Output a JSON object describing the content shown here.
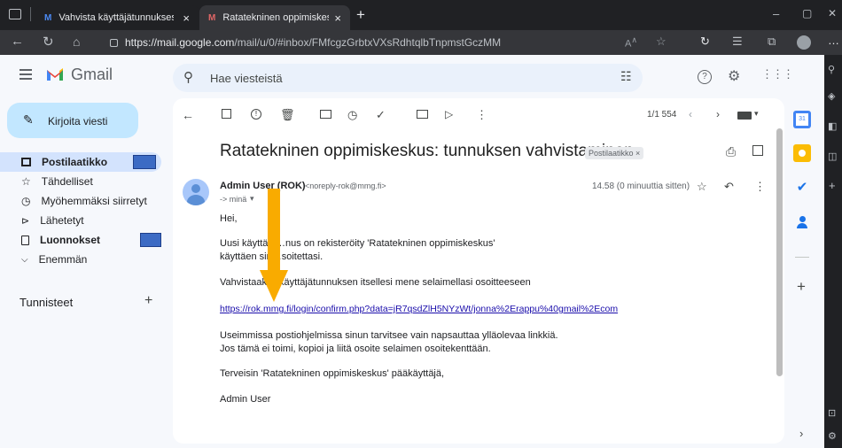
{
  "browser": {
    "tabs": [
      {
        "title": "Vahvista käyttäjätunnuksesi",
        "close": "×"
      },
      {
        "title": "Ratatekninen oppimiskeskus: tun",
        "close": "×"
      }
    ],
    "new_tab": "+",
    "window_controls": {
      "minimize": "–",
      "restore": "▢",
      "close": "✕"
    },
    "url_host": "https://mail.google.com",
    "url_path": "/mail/u/0/#inbox/FMfcgzGrbtxVXsRdhtqlbTnpmstGczMM"
  },
  "gmail": {
    "logo_text": "Gmail",
    "search_placeholder": "Hae viesteistä",
    "compose_label": "Kirjoita viesti",
    "nav": [
      {
        "label": "Postilaatikko",
        "icon": "inbox-icon"
      },
      {
        "label": "Tähdelliset",
        "icon": "star-icon"
      },
      {
        "label": "Myöhemmäksi siirretyt",
        "icon": "clock-icon"
      },
      {
        "label": "Lähetetyt",
        "icon": "send-icon"
      },
      {
        "label": "Luonnokset",
        "icon": "draft-icon"
      },
      {
        "label": "Enemmän",
        "icon": "chevron-down-icon"
      }
    ],
    "labels_header": "Tunnisteet",
    "labels_add": "+",
    "pagination": "1/1 554",
    "colors": {
      "accent": "#0b57d0",
      "selected": "#d3e3fd",
      "arrow": "#f9ab00",
      "link": "#1a0dab",
      "badge": "#3c6bc4"
    }
  },
  "email": {
    "subject": "Ratatekninen oppimiskeskus: tunnuksen vahvistaminen",
    "label_chip": "Postilaatikko",
    "label_chip_close": "×",
    "sender_name": "Admin User (ROK)",
    "sender_email": "<noreply-rok@mmg.fi>",
    "to": "-> minä",
    "time": "14.58 (0 minuuttia sitten)",
    "greeting": "Hei,",
    "line1": "Uusi käyttäjä…nus on rekisteröity 'Ratatekninen oppimiskeskus'",
    "line2": "käyttäen sin…soitettasi.",
    "line3": "Vahvistaak… käyttäjätunnuksen itsellesi mene selaimellasi osoitteeseen",
    "link": "https://rok.mmg.fi/login/confirm.php?data=jR7qsdZlH5NYzWt/jonna%2Erappu%40gmail%2Ecom",
    "line4": "Useimmissa postiohjelmissa sinun tarvitsee vain napsauttaa ylläolevaa linkkiä.",
    "line5": "Jos tämä ei toimi, kopioi ja liitä osoite selaimen osoitekenttään.",
    "line6": "Terveisin 'Ratatekninen oppimiskeskus' pääkäyttäjä,",
    "signature": "Admin User"
  }
}
